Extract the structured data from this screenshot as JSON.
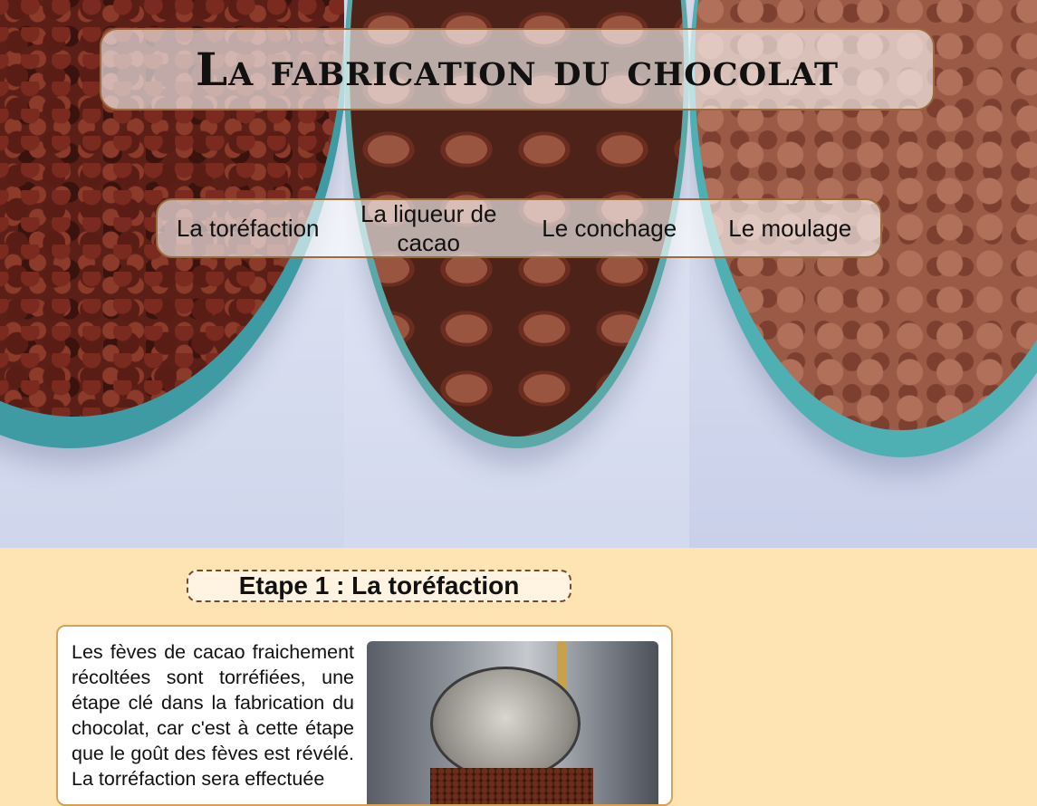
{
  "header": {
    "title": "La fabrication du chocolat"
  },
  "nav": {
    "items": [
      {
        "label": "La toréfaction"
      },
      {
        "label": "La liqueur de cacao"
      },
      {
        "label": "Le conchage"
      },
      {
        "label": "Le moulage"
      }
    ]
  },
  "main": {
    "step_title": "Etape 1 : La toréfaction",
    "paragraph": "Les fèves de cacao fraichement récoltées sont torréfiées, une étape clé dans la fabrication du chocolat, car c'est à cette étape que le goût des fèves est révélé. La torréfaction sera effectuée"
  },
  "colors": {
    "page_background": "#fee3b3",
    "border_accent": "#9b6a3f",
    "article_border": "#d6a155"
  }
}
